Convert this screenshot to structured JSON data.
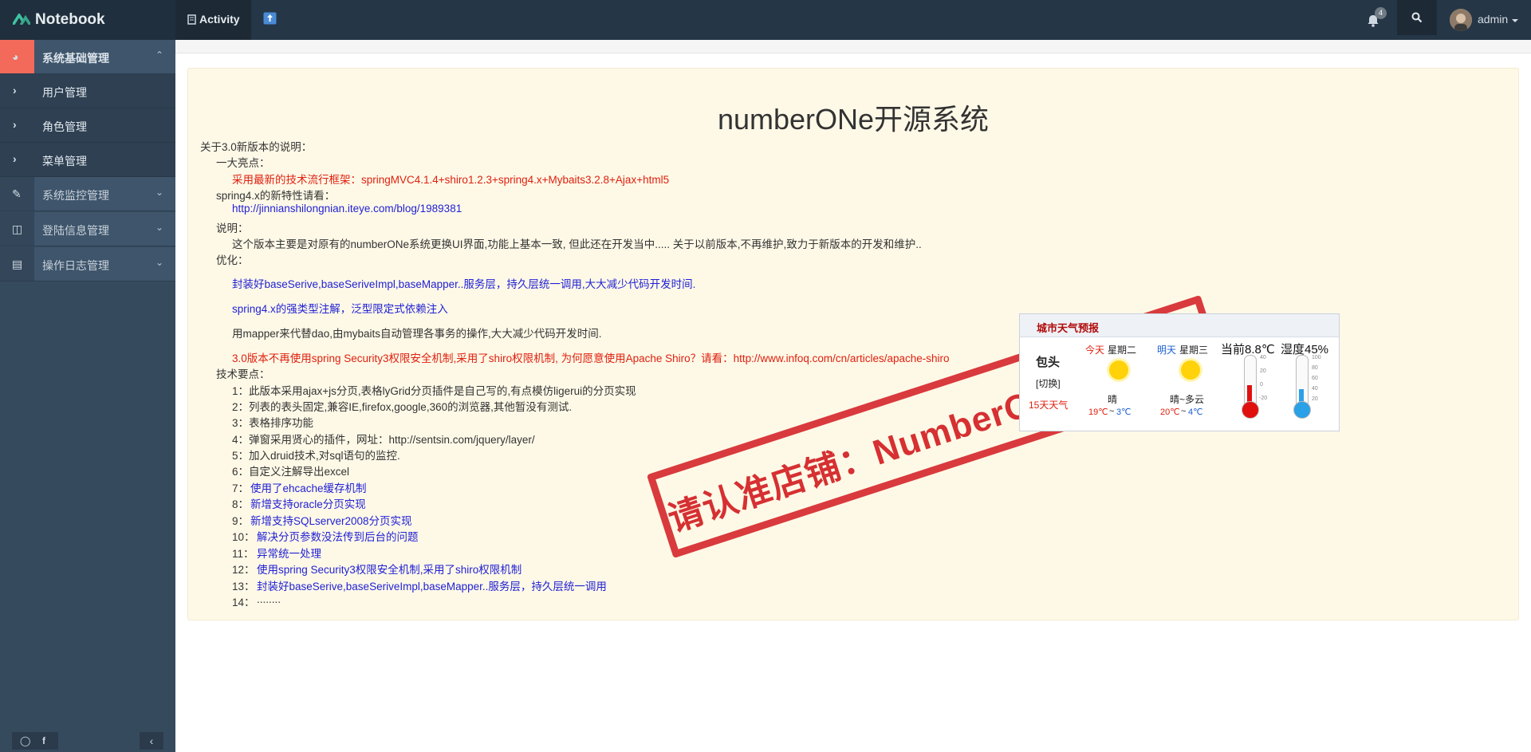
{
  "topbar": {
    "brand": "Notebook",
    "activity_label": "Activity",
    "notification_count": "4",
    "user_name": "admin"
  },
  "sidebar": {
    "groups": [
      {
        "label": "系统基础管理",
        "icon": "dashboard-icon",
        "expanded": true,
        "items": [
          {
            "label": "用户管理"
          },
          {
            "label": "角色管理"
          },
          {
            "label": "菜单管理"
          }
        ]
      },
      {
        "label": "系统监控管理",
        "icon": "edit-icon",
        "expanded": false
      },
      {
        "label": "登陆信息管理",
        "icon": "columns-icon",
        "expanded": false
      },
      {
        "label": "操作日志管理",
        "icon": "book-icon",
        "expanded": false
      }
    ],
    "footer": {
      "comment_icon": "comment-icon",
      "facebook_icon": "facebook-icon",
      "collapse_icon": "chevron-left-icon"
    }
  },
  "main": {
    "title": "numberONe开源系统",
    "lines": [
      "关于3.0新版本的说明：",
      "一大亮点：",
      "采用最新的技术流行框架：springMVC4.1.4+shiro1.2.3+spring4.x+Mybaits3.2.8+Ajax+html5",
      "spring4.x的新特性请看：",
      "http://jinnianshilongnian.iteye.com/blog/1989381",
      "说明：",
      "这个版本主要是对原有的numberONe系统更换UI界面,功能上基本一致, 但此还在开发当中..... 关于以前版本,不再维护,致力于新版本的开发和维护..",
      "优化：",
      "封装好baseSerive,baseSeriveImpl,baseMapper..服务层，持久层统一调用,大大减少代码开发时间.",
      "spring4.x的强类型注解，泛型限定式依赖注入",
      "用mapper来代替dao,由mybaits自动管理各事务的操作,大大减少代码开发时间.",
      "3.0版本不再使用spring Security3权限安全机制,采用了shiro权限机制, 为何愿意使用Apache Shiro？请看：http://www.infoq.com/cn/articles/apache-shiro",
      "技术要点：",
      "1：此版本采用ajax+js分页,表格lyGrid分页插件是自己写的,有点模仿ligerui的分页实现",
      "2：列表的表头固定,兼容IE,firefox,google,360的浏览器,其他暂没有测试.",
      "3：表格排序功能",
      "4：弹窗采用贤心的插件，网址：http://sentsin.com/jquery/layer/",
      "5：加入druid技术,对sql语句的监控.",
      "6：自定义注解导出excel",
      "7：",
      "使用了ehcache缓存机制",
      "8：",
      "新增支持oracle分页实现",
      "9：",
      "新增支持SQLserver2008分页实现",
      "10：",
      "解决分页参数没法传到后台的问题",
      "11：",
      "异常统一处理",
      "12：",
      "使用spring Security3权限安全机制,采用了shiro权限机制",
      "13：",
      "封装好baseSerive,baseSeriveImpl,baseMapper..服务层，持久层统一调用",
      "14：",
      "........"
    ]
  },
  "weather": {
    "title": "城市天气预报",
    "city": "包头",
    "switch_label": "[切换]",
    "forecast_link": "15天天气",
    "today_label": "今天",
    "today_weekday": "星期二",
    "today_condition": "晴",
    "today_high": "19℃",
    "today_sep": "~",
    "today_low": "3℃",
    "tomorrow_label": "明天",
    "tomorrow_weekday": "星期三",
    "tomorrow_condition": "晴~多云",
    "tomorrow_high": "20℃",
    "tomorrow_sep": "~",
    "tomorrow_low": "4℃",
    "current_temp": "当前8.8℃",
    "humidity": "湿度45%",
    "temp_fill": 0.55,
    "humidity_fill": 0.45,
    "temp_ticks": [
      "40",
      "20",
      "0",
      "-20"
    ],
    "humidity_ticks": [
      "100",
      "80",
      "60",
      "40",
      "20"
    ]
  },
  "stamp": {
    "text": "请认准店铺：NumberOne专业开发"
  },
  "colors": {
    "topbar": "#253647",
    "sidebar": "#364a5e",
    "accent": "#f36a5a",
    "red_text": "#e0200f",
    "blue_text": "#1f1fd5",
    "panel_bg": "#fef9e7"
  }
}
